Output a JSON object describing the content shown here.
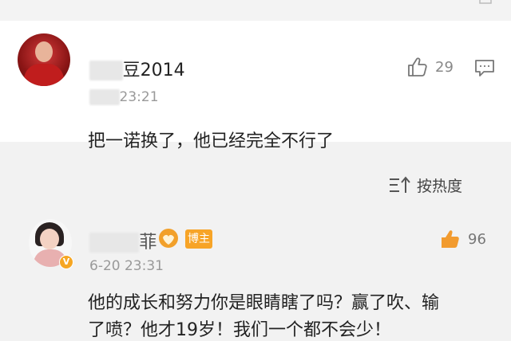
{
  "comment1": {
    "username": "豆2014",
    "time": "23:21",
    "text": "把一诺换了，他已经完全不行了",
    "likes": "29"
  },
  "sort": {
    "label": "按热度"
  },
  "comment2": {
    "username": "菲",
    "badge": "博主",
    "time": "6-20 23:31",
    "line1": "他的成长和努力你是眼睛瞎了吗？赢了吹、输",
    "line2": "了喷？他才19岁！我们一个都不会少！",
    "likes": "96"
  },
  "colors": {
    "accent_orange": "#f7a427",
    "text_primary": "#222222",
    "text_secondary": "#999999",
    "background": "#f2f2f2"
  },
  "icons": [
    "thumbs-up-icon",
    "comment-icon",
    "sort-icon",
    "medal-icon",
    "verified-icon"
  ]
}
